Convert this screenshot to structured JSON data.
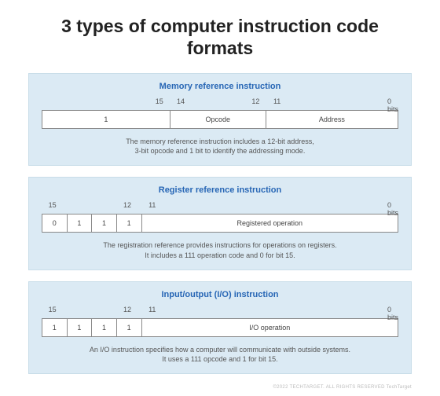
{
  "title": "3 types of computer instruction code formats",
  "panels": {
    "memory": {
      "title": "Memory reference instruction",
      "bits": {
        "b0": "15",
        "b1": "14",
        "b2": "12",
        "b3": "11",
        "b4": "0 bits"
      },
      "cells": {
        "c0": "1",
        "c1": "Opcode",
        "c2": "Address"
      },
      "descr": "The memory reference instruction includes a 12-bit address,\n3-bit opcode and 1 bit to identify the addressing mode."
    },
    "register": {
      "title": "Register reference instruction",
      "bits": {
        "b0": "15",
        "b1": "12",
        "b2": "11",
        "b3": "0 bits"
      },
      "cells": {
        "c0": "0",
        "c1": "1",
        "c2": "1",
        "c3": "1",
        "c4": "Registered operation"
      },
      "descr": "The registration reference provides instructions for operations on registers.\nIt includes a 111 operation code and 0 for bit 15."
    },
    "io": {
      "title": "Input/output (I/O) instruction",
      "bits": {
        "b0": "15",
        "b1": "12",
        "b2": "11",
        "b3": "0 bits"
      },
      "cells": {
        "c0": "1",
        "c1": "1",
        "c2": "1",
        "c3": "1",
        "c4": "I/O operation"
      },
      "descr": "An I/O instruction specifies how a computer will communicate with outside systems.\nIt uses a 111 opcode and 1 for bit 15."
    }
  },
  "footnote": "©2022 TECHTARGET. ALL RIGHTS RESERVED    TechTarget"
}
